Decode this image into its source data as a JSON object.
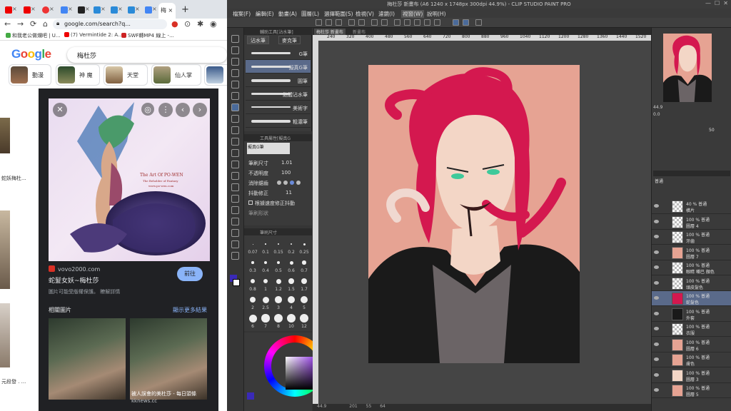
{
  "browser": {
    "active_tab_label": "梅",
    "url": "google.com/search?q...",
    "bookmarks": [
      "和我老公做爛吧 | U...",
      "(7) Vermintide 2: A...",
      "SWF轉MP4 線上 -..."
    ],
    "search_query": "梅杜莎",
    "logo": "Google",
    "chips": [
      "動漫",
      "神 魔",
      "天堂",
      "仙人掌"
    ],
    "left_snippets": [
      "蛇妖梅杜...",
      "元段發 . ..."
    ],
    "panel": {
      "source": "vovo2000.com",
      "title": "蛇髮女妖~梅杜莎",
      "note": "圖片可能受版權保護。 瞭解詳情",
      "visit": "前往",
      "related_heading": "相關圖片",
      "related_more": "顯示更多結果",
      "related_title": "被人誤會的美杜莎 - 每日頭條",
      "related_source": "kknews.cc",
      "art_caption_1": "The Art Of PO-WEN",
      "art_caption_2": "The Beholder of Fantasy",
      "art_caption_3": "www.po-wen.com"
    }
  },
  "csp": {
    "title": "梅杜莎 新畫布 (A6 1240 x 1748px 300dpi 44.9%) - CLIP STUDIO PAINT PRO",
    "menus": [
      "檔案(F)",
      "編輯(E)",
      "動畫(A)",
      "圖層(L)",
      "選擇範圍(S)",
      "檢視(V)",
      "濾鏡(I)",
      "視窗(W)",
      "說明(H)"
    ],
    "subtool_header": "輔助工具[沾水筆]",
    "subtool_tabs": [
      "沾水筆",
      "麥克筆"
    ],
    "brushes": [
      "G筆",
      "擬真G筆",
      "圓筆",
      "飽體沾水筆",
      "美術字",
      "粗濃筆"
    ],
    "toolprop_header": "工具屬性[擬真G筆]",
    "toolprop_name": "擬真G筆",
    "props": [
      {
        "label": "筆刷尺寸",
        "value": "1.01"
      },
      {
        "label": "不透明度",
        "value": "100"
      },
      {
        "label": "消除鋸齒",
        "value": ""
      },
      {
        "label": "抖動修正",
        "value": "11"
      },
      {
        "label": "根據速度修正抖動",
        "value": ""
      },
      {
        "label": "筆刷形狀",
        "value": ""
      }
    ],
    "brushsize_header": "筆刷尺寸",
    "brush_sizes": [
      "0.07",
      "0.1",
      "0.15",
      "0.2",
      "0.25",
      "0.3",
      "0.4",
      "0.5",
      "0.6",
      "0.7",
      "0.8",
      "1",
      "1.2",
      "1.5",
      "1.7",
      "2",
      "2.5",
      "3",
      "4",
      "5",
      "6",
      "7",
      "8",
      "10",
      "12"
    ],
    "canvas_tabs": [
      "梅杜莎 新畫布",
      "新畫布"
    ],
    "ruler_ticks": [
      "240",
      "320",
      "400",
      "480",
      "560",
      "640",
      "720",
      "800",
      "880",
      "960",
      "1040",
      "1120",
      "1200",
      "1280",
      "1360",
      "1440",
      "1520"
    ],
    "zoom": "44.9",
    "rotation": "0.0",
    "status_zoom": "44.9",
    "status_coords": "201",
    "status_coords2": "55",
    "status_coords3": "64",
    "layer_blend": "普通",
    "layer_opacity": "50",
    "layers": [
      {
        "opacity": "40 % 普通",
        "name": "橫片"
      },
      {
        "opacity": "100 % 普通",
        "name": "圖層 4"
      },
      {
        "opacity": "100 % 普通",
        "name": "牙齒"
      },
      {
        "opacity": "100 % 普通",
        "name": "圖層 7"
      },
      {
        "opacity": "100 % 普通",
        "name": "眼睛 嘴巴 顏色"
      },
      {
        "opacity": "100 % 普通",
        "name": "頭皮髮色"
      },
      {
        "opacity": "100 % 普通",
        "name": "蛇髮色"
      },
      {
        "opacity": "100 % 普通",
        "name": "外套"
      },
      {
        "opacity": "100 % 普通",
        "name": "衣服"
      },
      {
        "opacity": "100 % 普通",
        "name": "圖層 6"
      },
      {
        "opacity": "100 % 普通",
        "name": "膚色"
      },
      {
        "opacity": "100 % 普通",
        "name": "圖層 3"
      },
      {
        "opacity": "100 % 普通",
        "name": "圖層 5"
      }
    ]
  },
  "colors": {
    "canvas_bg": "#e6a393",
    "hair": "#d4184f",
    "jacket": "#1a1a1a",
    "shirt": "#6b6466",
    "skin": "#f3d6c6",
    "eyes": "#3ec99a"
  }
}
